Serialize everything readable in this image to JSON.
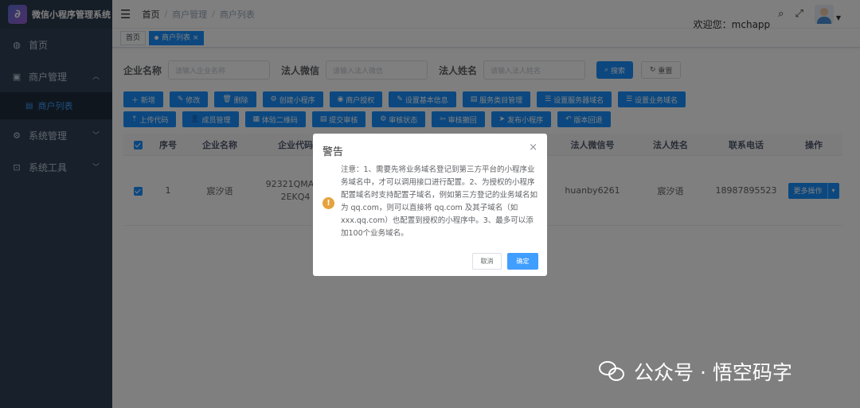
{
  "sidebar": {
    "app_title": "微信小程序管理系统",
    "logo_letter": "∂",
    "items": [
      {
        "label": "首页",
        "icon": "dashboard-icon"
      },
      {
        "label": "商户管理",
        "icon": "store-icon"
      },
      {
        "label": "商户列表",
        "icon": "list-icon"
      },
      {
        "label": "系统管理",
        "icon": "gear-icon"
      },
      {
        "label": "系统工具",
        "icon": "toolbox-icon"
      }
    ]
  },
  "navbar": {
    "breadcrumb": [
      "首页",
      "商户管理",
      "商户列表"
    ],
    "separator": "/",
    "welcome": "欢迎您：mchapp"
  },
  "tags": [
    "首页",
    "商户列表"
  ],
  "tag_close": "×",
  "search": {
    "company_label": "企业名称",
    "company_placeholder": "请输入企业名称",
    "wechat_label": "法人微信",
    "wechat_placeholder": "请输入法人微信",
    "name_label": "法人姓名",
    "name_placeholder": "请输入法人姓名",
    "search_btn": "搜索",
    "reset_btn": "重置"
  },
  "toolbar": {
    "row1": [
      "新增",
      "修改",
      "删除",
      "创建小程序",
      "商户授权",
      "设置基本信息",
      "服务类目管理",
      "设置服务器域名",
      "设置业务域名"
    ],
    "row2": [
      "上传代码",
      "成员管理",
      "体验二维码",
      "提交审核",
      "审核状态",
      "审核撤回",
      "发布小程序",
      "版本回退"
    ]
  },
  "table": {
    "headers": [
      "序号",
      "企业名称",
      "企业代码",
      "",
      "",
      "",
      "法人微信号",
      "法人姓名",
      "联系电话",
      "操作"
    ],
    "row": {
      "index": "1",
      "company": "宸汐语",
      "code_line1": "92321QMA34",
      "code_line2": "2EKQ4",
      "wechat": "huanby6261",
      "name": "宸汐语",
      "phone": "18987895523",
      "action": "更多操作"
    }
  },
  "dialog": {
    "title": "警告",
    "close": "×",
    "warn_symbol": "!",
    "body": "注意：1、需要先将业务域名登记到第三方平台的小程序业务域名中，才可以调用接口进行配置。2、为授权的小程序配置域名时支持配置子域名，例如第三方登记的业务域名如为 qq.com，则可以直接将 qq.com 及其子域名（如 xxx.qq.com）也配置到授权的小程序中。3、最多可以添加100个业务域名。",
    "cancel": "取消",
    "confirm": "确定"
  },
  "watermark": "公众号 · 悟空码字",
  "colors": {
    "primary": "#1890ff",
    "sidebar_bg": "#304156",
    "warning": "#e6a23c"
  }
}
